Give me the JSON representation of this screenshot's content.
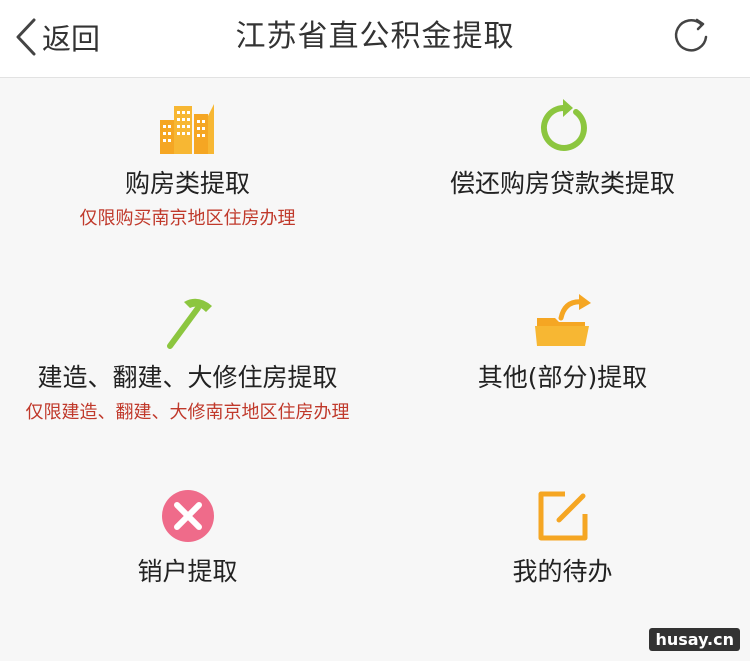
{
  "header": {
    "back_label": "返回",
    "title": "江苏省直公积金提取"
  },
  "tiles": [
    {
      "label": "购房类提取",
      "note": "仅限购买南京地区住房办理",
      "icon": "buildings-icon"
    },
    {
      "label": "偿还购房贷款类提取",
      "note": "",
      "icon": "refresh-green-icon"
    },
    {
      "label": "建造、翻建、大修住房提取",
      "note": "仅限建造、翻建、大修南京地区住房办理",
      "icon": "hammer-icon"
    },
    {
      "label": "其他(部分)提取",
      "note": "",
      "icon": "folder-arrow-icon"
    },
    {
      "label": "销户提取",
      "note": "",
      "icon": "close-circle-icon"
    },
    {
      "label": "我的待办",
      "note": "",
      "icon": "edit-square-icon"
    }
  ],
  "colors": {
    "accent_red": "#c0392b",
    "green": "#8cc63f",
    "orange": "#f5a623",
    "pink": "#ef6b8a"
  },
  "watermark": "husay.cn"
}
